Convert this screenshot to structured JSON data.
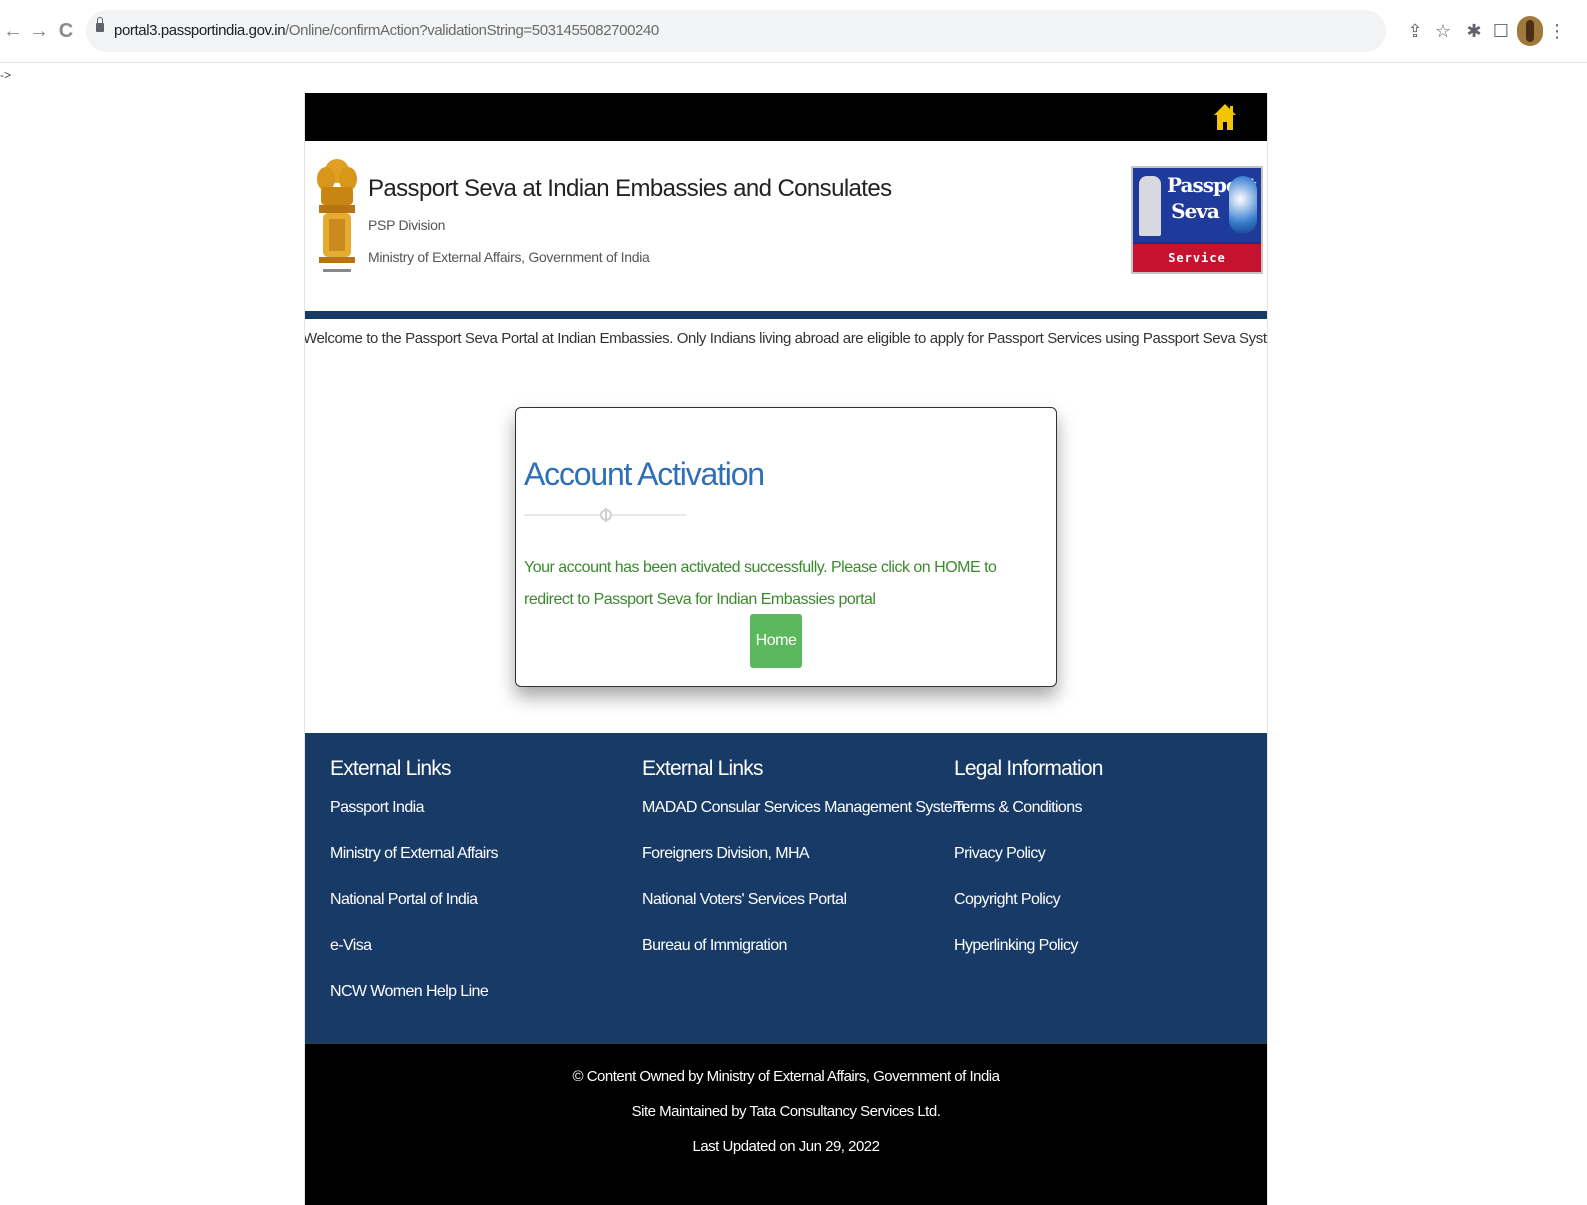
{
  "browser": {
    "url_host": "portal3.passportindia.gov.in",
    "url_path": "/Online/confirmAction?validationString=5031455082700240",
    "back_icon": "arrow-left-icon",
    "forward_icon": "arrow-right-icon",
    "reload_icon": "reload-icon",
    "nav_glyphs": {
      "back": "←",
      "forward": "→",
      "reload": "C"
    },
    "toolbar_glyphs": {
      "share": "⇪",
      "star": "☆",
      "extensions": "✱",
      "sidepanel": "☐",
      "menu": "⋮"
    }
  },
  "stray_text": "->",
  "header": {
    "title": "Passport Seva at Indian Embassies and Consulates",
    "division": "PSP Division",
    "ministry": "Ministry of External Affairs, Government of India",
    "logo": {
      "line1": "Passport",
      "line2": "Seva",
      "tagline": "Service Excellence"
    }
  },
  "marquee": "Welcome to the Passport Seva Portal at Indian Embassies. Only Indians living abroad are eligible to apply for Passport Services using Passport Seva System under the jurisdiction of the res",
  "activation": {
    "title": "Account Activation",
    "message": "Your account has been activated successfully. Please click on HOME to redirect to Passport Seva for Indian Embassies portal",
    "button": "Home"
  },
  "footer": {
    "columns": [
      {
        "heading": "External Links",
        "links": [
          "Passport India",
          "Ministry of External Affairs",
          "National Portal of India",
          "e-Visa",
          "NCW Women Help Line"
        ]
      },
      {
        "heading": "External Links",
        "links": [
          "MADAD Consular Services Management System",
          "Foreigners Division, MHA",
          "National Voters' Services Portal",
          "Bureau of Immigration"
        ]
      },
      {
        "heading": "Legal Information",
        "links": [
          "Terms & Conditions",
          "Privacy Policy",
          "Copyright Policy",
          "Hyperlinking Policy"
        ]
      }
    ],
    "copyright": "© Content Owned by Ministry of External Affairs, Government of India",
    "maintained": "Site Maintained by Tata Consultancy Services Ltd.",
    "updated": "Last Updated on Jun 29, 2022"
  },
  "colors": {
    "navy": "#173a67",
    "title_blue": "#2f6fb7",
    "success_green": "#3a8a2c",
    "button_green": "#5cb85c",
    "home_icon": "#f2c500"
  }
}
